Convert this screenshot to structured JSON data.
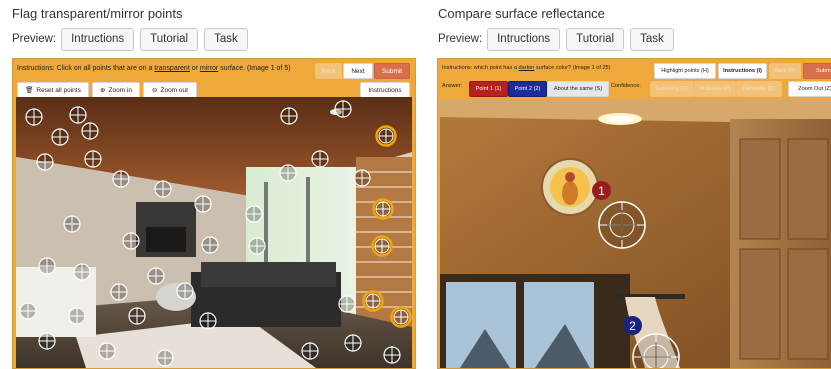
{
  "left_panel": {
    "title": "Flag transparent/mirror points",
    "preview_label": "Preview:",
    "tabs": [
      "Intructions",
      "Tutorial",
      "Task"
    ],
    "instruction_prefix": "Instructions: Click on all points that are on a ",
    "instruction_link1": "transparent",
    "instruction_mid": " or ",
    "instruction_link2": "mirror",
    "instruction_suffix": " surface. (Image 1 of 5)",
    "back_label": "Back",
    "next_label": "Next",
    "submit_label": "Submit",
    "reset_label": "Reset all points",
    "zoom_in_label": "Zoom in",
    "zoom_out_label": "Zoom out",
    "instructions_label": "Instructions"
  },
  "right_panel": {
    "title": "Compare surface reflectance",
    "preview_label": "Preview:",
    "tabs": [
      "Intructions",
      "Tutorial",
      "Task"
    ],
    "instruction_prefix": "Instructions: which point has a ",
    "instruction_link": "darker",
    "instruction_suffix": " surface color? (Image 1 of 25)",
    "highlight_label": "Highlight points (H)",
    "instructions_label": "Instructions (I)",
    "back_label": "Back (B)",
    "submit_label": "Submi",
    "answer_label": "Answer:",
    "point1_label": "Point 1 (1)",
    "point2_label": "Point 2 (2)",
    "same_label": "About the same (S)",
    "confidence_label": "Confidence:",
    "guessing_label": "Guessing (G)",
    "probably_label": "Probably (P)",
    "definitely_label": "Definitely (D)",
    "zoom_out_label": "Zoom Out (Z)",
    "marker1": "1",
    "marker2": "2"
  },
  "colors": {
    "frame_orange": "#efa93a",
    "submit": "#d9704b",
    "point1_red": "#b82020",
    "point2_blue": "#1d2a9a",
    "selected_ring": "#f5a500",
    "marker1_bg": "#9b1b1b",
    "marker2_bg": "#1a237e"
  },
  "icons": [
    "trash-icon",
    "zoom-in-icon",
    "zoom-out-icon",
    "crosshair-icon"
  ]
}
